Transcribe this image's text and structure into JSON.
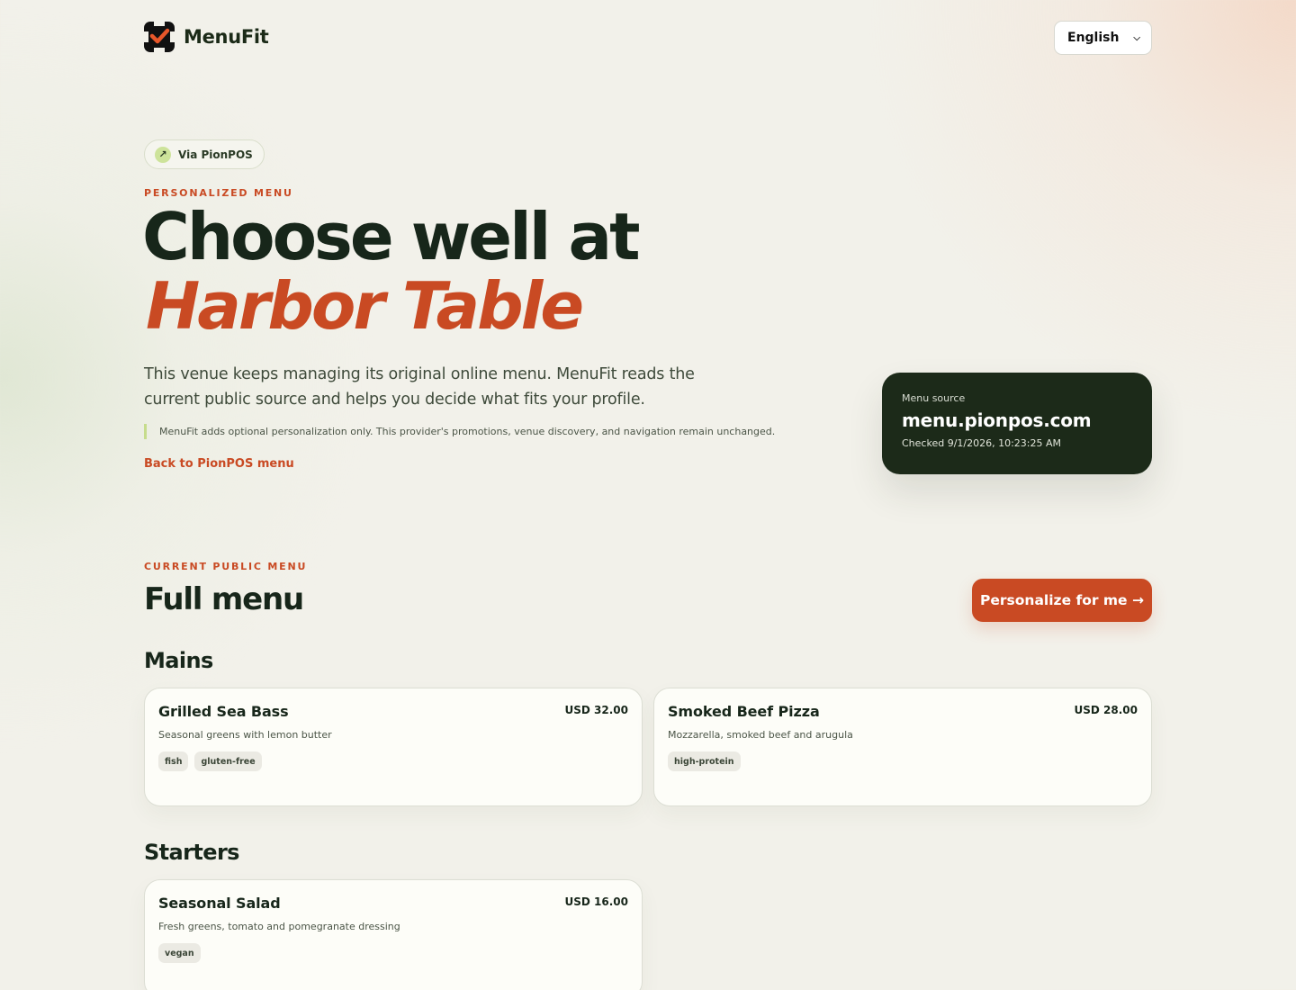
{
  "header": {
    "brand": "MenuFit",
    "language": "English"
  },
  "hero": {
    "via_badge": "Via PionPOS",
    "eyebrow": "PERSONALIZED MENU",
    "title_line1": "Choose well at",
    "title_line2": "Harbor Table",
    "description": "This venue keeps managing its original online menu. MenuFit reads the current public source and helps you decide what fits your profile.",
    "note": "MenuFit adds optional personalization only. This provider's promotions, venue discovery, and navigation remain unchanged.",
    "back_link": "Back to PionPOS menu"
  },
  "source": {
    "label": "Menu source",
    "domain": "menu.pionpos.com",
    "checked": "Checked 9/1/2026, 10:23:25 AM"
  },
  "menu": {
    "eyebrow": "CURRENT PUBLIC MENU",
    "title": "Full menu",
    "personalize_button": "Personalize for me →",
    "categories": [
      {
        "name": "Mains",
        "items": [
          {
            "name": "Grilled Sea Bass",
            "price": "USD 32.00",
            "description": "Seasonal greens with lemon butter",
            "tags": [
              "fish",
              "gluten-free"
            ]
          },
          {
            "name": "Smoked Beef Pizza",
            "price": "USD 28.00",
            "description": "Mozzarella, smoked beef and arugula",
            "tags": [
              "high-protein"
            ]
          }
        ]
      },
      {
        "name": "Starters",
        "items": [
          {
            "name": "Seasonal Salad",
            "price": "USD 16.00",
            "description": "Fresh greens, tomato and pomegranate dressing",
            "tags": [
              "vegan"
            ]
          }
        ]
      }
    ]
  },
  "colors": {
    "accent": "#c94a23",
    "dark": "#1c2a19",
    "background": "#f2f1ea",
    "lime": "#c6dc8c"
  }
}
